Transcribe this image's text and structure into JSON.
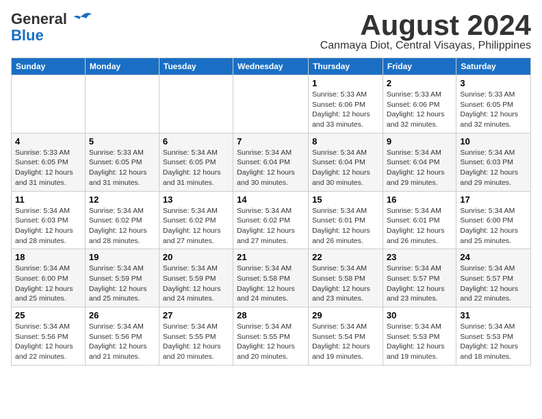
{
  "logo": {
    "line1": "General",
    "line2": "Blue"
  },
  "title": "August 2024",
  "subtitle": "Canmaya Diot, Central Visayas, Philippines",
  "weekdays": [
    "Sunday",
    "Monday",
    "Tuesday",
    "Wednesday",
    "Thursday",
    "Friday",
    "Saturday"
  ],
  "weeks": [
    [
      {
        "num": "",
        "info": ""
      },
      {
        "num": "",
        "info": ""
      },
      {
        "num": "",
        "info": ""
      },
      {
        "num": "",
        "info": ""
      },
      {
        "num": "1",
        "info": "Sunrise: 5:33 AM\nSunset: 6:06 PM\nDaylight: 12 hours\nand 33 minutes."
      },
      {
        "num": "2",
        "info": "Sunrise: 5:33 AM\nSunset: 6:06 PM\nDaylight: 12 hours\nand 32 minutes."
      },
      {
        "num": "3",
        "info": "Sunrise: 5:33 AM\nSunset: 6:05 PM\nDaylight: 12 hours\nand 32 minutes."
      }
    ],
    [
      {
        "num": "4",
        "info": "Sunrise: 5:33 AM\nSunset: 6:05 PM\nDaylight: 12 hours\nand 31 minutes."
      },
      {
        "num": "5",
        "info": "Sunrise: 5:33 AM\nSunset: 6:05 PM\nDaylight: 12 hours\nand 31 minutes."
      },
      {
        "num": "6",
        "info": "Sunrise: 5:34 AM\nSunset: 6:05 PM\nDaylight: 12 hours\nand 31 minutes."
      },
      {
        "num": "7",
        "info": "Sunrise: 5:34 AM\nSunset: 6:04 PM\nDaylight: 12 hours\nand 30 minutes."
      },
      {
        "num": "8",
        "info": "Sunrise: 5:34 AM\nSunset: 6:04 PM\nDaylight: 12 hours\nand 30 minutes."
      },
      {
        "num": "9",
        "info": "Sunrise: 5:34 AM\nSunset: 6:04 PM\nDaylight: 12 hours\nand 29 minutes."
      },
      {
        "num": "10",
        "info": "Sunrise: 5:34 AM\nSunset: 6:03 PM\nDaylight: 12 hours\nand 29 minutes."
      }
    ],
    [
      {
        "num": "11",
        "info": "Sunrise: 5:34 AM\nSunset: 6:03 PM\nDaylight: 12 hours\nand 28 minutes."
      },
      {
        "num": "12",
        "info": "Sunrise: 5:34 AM\nSunset: 6:02 PM\nDaylight: 12 hours\nand 28 minutes."
      },
      {
        "num": "13",
        "info": "Sunrise: 5:34 AM\nSunset: 6:02 PM\nDaylight: 12 hours\nand 27 minutes."
      },
      {
        "num": "14",
        "info": "Sunrise: 5:34 AM\nSunset: 6:02 PM\nDaylight: 12 hours\nand 27 minutes."
      },
      {
        "num": "15",
        "info": "Sunrise: 5:34 AM\nSunset: 6:01 PM\nDaylight: 12 hours\nand 26 minutes."
      },
      {
        "num": "16",
        "info": "Sunrise: 5:34 AM\nSunset: 6:01 PM\nDaylight: 12 hours\nand 26 minutes."
      },
      {
        "num": "17",
        "info": "Sunrise: 5:34 AM\nSunset: 6:00 PM\nDaylight: 12 hours\nand 25 minutes."
      }
    ],
    [
      {
        "num": "18",
        "info": "Sunrise: 5:34 AM\nSunset: 6:00 PM\nDaylight: 12 hours\nand 25 minutes."
      },
      {
        "num": "19",
        "info": "Sunrise: 5:34 AM\nSunset: 5:59 PM\nDaylight: 12 hours\nand 25 minutes."
      },
      {
        "num": "20",
        "info": "Sunrise: 5:34 AM\nSunset: 5:59 PM\nDaylight: 12 hours\nand 24 minutes."
      },
      {
        "num": "21",
        "info": "Sunrise: 5:34 AM\nSunset: 5:58 PM\nDaylight: 12 hours\nand 24 minutes."
      },
      {
        "num": "22",
        "info": "Sunrise: 5:34 AM\nSunset: 5:58 PM\nDaylight: 12 hours\nand 23 minutes."
      },
      {
        "num": "23",
        "info": "Sunrise: 5:34 AM\nSunset: 5:57 PM\nDaylight: 12 hours\nand 23 minutes."
      },
      {
        "num": "24",
        "info": "Sunrise: 5:34 AM\nSunset: 5:57 PM\nDaylight: 12 hours\nand 22 minutes."
      }
    ],
    [
      {
        "num": "25",
        "info": "Sunrise: 5:34 AM\nSunset: 5:56 PM\nDaylight: 12 hours\nand 22 minutes."
      },
      {
        "num": "26",
        "info": "Sunrise: 5:34 AM\nSunset: 5:56 PM\nDaylight: 12 hours\nand 21 minutes."
      },
      {
        "num": "27",
        "info": "Sunrise: 5:34 AM\nSunset: 5:55 PM\nDaylight: 12 hours\nand 20 minutes."
      },
      {
        "num": "28",
        "info": "Sunrise: 5:34 AM\nSunset: 5:55 PM\nDaylight: 12 hours\nand 20 minutes."
      },
      {
        "num": "29",
        "info": "Sunrise: 5:34 AM\nSunset: 5:54 PM\nDaylight: 12 hours\nand 19 minutes."
      },
      {
        "num": "30",
        "info": "Sunrise: 5:34 AM\nSunset: 5:53 PM\nDaylight: 12 hours\nand 19 minutes."
      },
      {
        "num": "31",
        "info": "Sunrise: 5:34 AM\nSunset: 5:53 PM\nDaylight: 12 hours\nand 18 minutes."
      }
    ]
  ]
}
